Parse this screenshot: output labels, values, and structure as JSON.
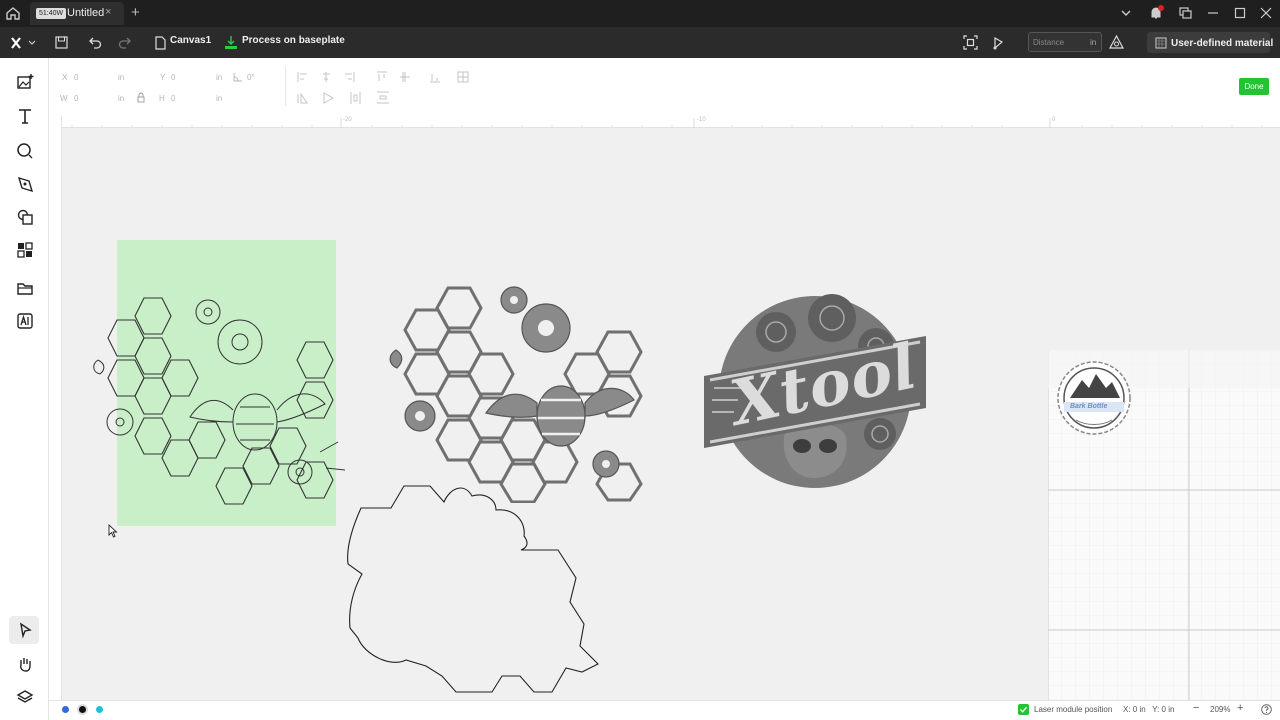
{
  "titlebar": {
    "tab_badge": "51:40W",
    "tab_title": "Untitled",
    "tab_close": "×",
    "tab_add": "+"
  },
  "toolbar": {
    "canvas_label": "Canvas1",
    "process_label": "Process on baseplate",
    "distance_placeholder": "Distance",
    "distance_unit": "in",
    "material_label": "User-defined material"
  },
  "properties": {
    "x_label": "X",
    "x_value": "0",
    "x_unit": "in",
    "y_label": "Y",
    "y_value": "0",
    "y_unit": "in",
    "angle_value": "0°",
    "w_label": "W",
    "w_value": "0",
    "w_unit": "in",
    "h_label": "H",
    "h_value": "0",
    "h_unit": "in",
    "done_label": "Done"
  },
  "ruler": {
    "marks": [
      "-20",
      "-10",
      "0"
    ]
  },
  "canvas": {
    "logo_text": "Xtool",
    "badge_text": "Bark Bottle"
  },
  "statusbar": {
    "colors": [
      "#2f6bd6",
      "#111111",
      "#1fc0d8"
    ],
    "laser_position_label": "Laser module position",
    "coords": "X: 0 in   Y: 0 in",
    "zoom": "209%",
    "zoom_minus": "−",
    "zoom_plus": "+"
  },
  "colors": {
    "accent": "#23c433",
    "selection": "#c9efc9"
  }
}
